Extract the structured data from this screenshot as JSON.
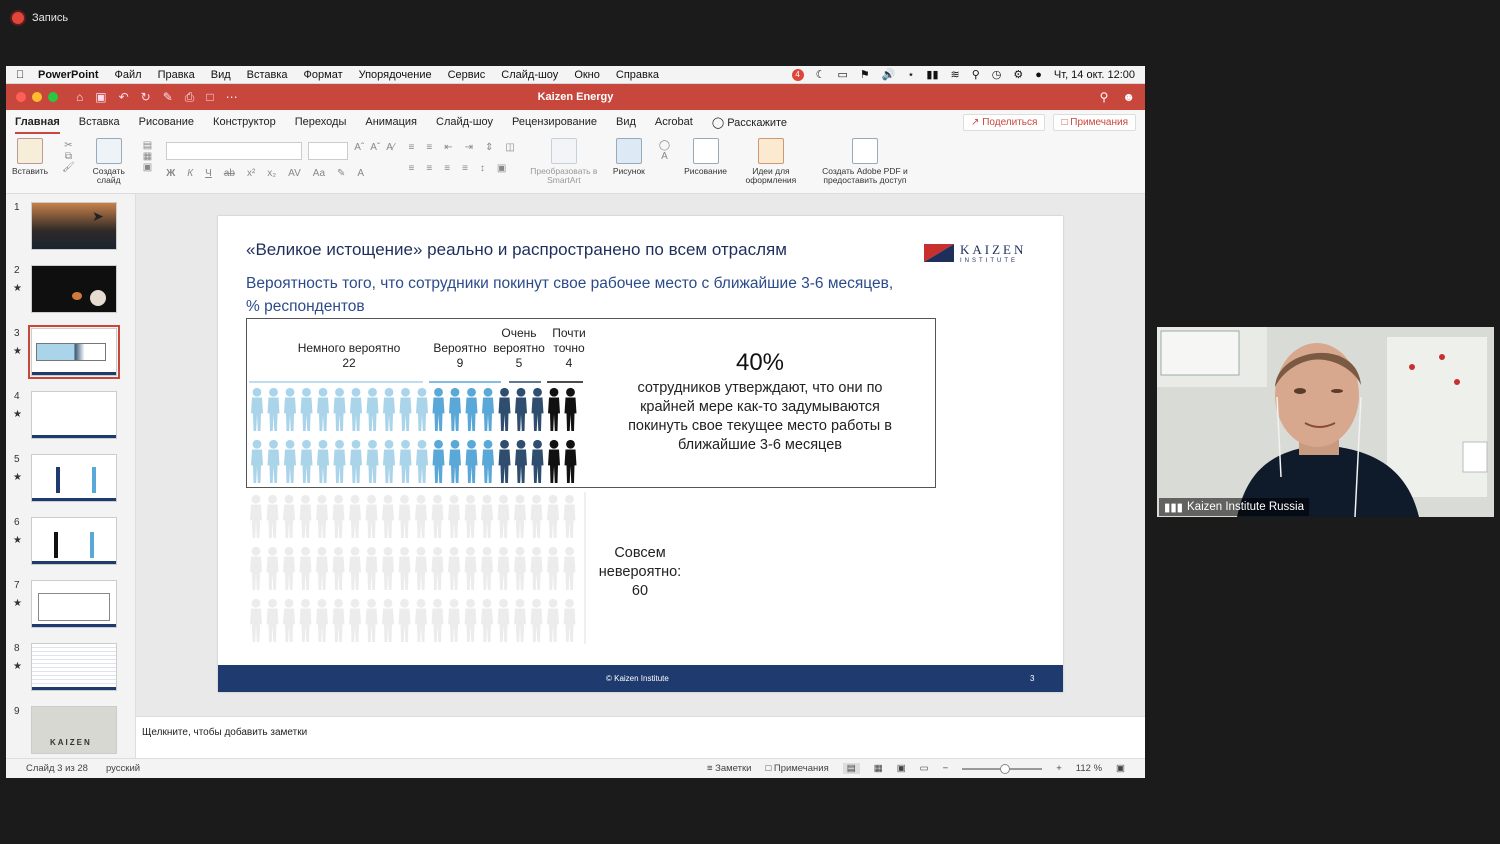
{
  "recording": {
    "label": "Запись"
  },
  "menubar": {
    "app": "PowerPoint",
    "items": [
      "Файл",
      "Правка",
      "Вид",
      "Вставка",
      "Формат",
      "Упорядочение",
      "Сервис",
      "Слайд-шоу",
      "Окно",
      "Справка"
    ],
    "notification_count": "4",
    "clock": "Чт, 14 окт.  12:00"
  },
  "titlebar": {
    "document": "Kaizen Energy"
  },
  "tabs": {
    "items": [
      "Главная",
      "Вставка",
      "Рисование",
      "Конструктор",
      "Переходы",
      "Анимация",
      "Слайд-шоу",
      "Рецензирование",
      "Вид",
      "Acrobat"
    ],
    "tell_me": "Расскажите",
    "share": "Поделиться",
    "comments": "Примечания"
  },
  "ribbon": {
    "paste": "Вставить",
    "new_slide": "Создать слайд",
    "smartart": "Преобразовать в SmartArt",
    "picture": "Рисунок",
    "drawing": "Рисование",
    "design_ideas": "Идеи для оформления",
    "adobe": "Создать Adobe PDF и предоставить доступ"
  },
  "thumbnails": {
    "numbers": [
      "1",
      "2",
      "3",
      "4",
      "5",
      "6",
      "7",
      "8",
      "9"
    ],
    "slide9_word": "KAIZEN"
  },
  "slide": {
    "title": "«Великое истощение» реально и распространено по всем отраслям",
    "subtitle": "Вероятность того, что сотрудники покинут свое рабочее место с ближайшие 3-6 месяцев, % респондентов",
    "logo": "KAIZEN",
    "logo_sub": "INSTITUTE",
    "categories": [
      {
        "label": "Немного вероятно",
        "value": "22"
      },
      {
        "label": "Вероятно",
        "value": "9"
      },
      {
        "label": "Очень вероятно",
        "value": "5"
      },
      {
        "label": "Почти точно",
        "value": "4"
      }
    ],
    "headline_pct": "40%",
    "headline_text": "сотрудников утверждают, что они по крайней мере как-то задумываются покинуть свое текущее место работы в ближайшие 3-6 месяцев",
    "unlikely_label": "Совсем невероятно:",
    "unlikely_value": "60",
    "footer": "© Kaizen Institute",
    "page": "3",
    "colors": {
      "light": "#a9d4ea",
      "mid": "#5aa8d8",
      "dark": "#2f4d6e",
      "black": "#111",
      "grey": "#ececec",
      "navy": "#1e3a6e"
    }
  },
  "notes": {
    "placeholder": "Щелкните, чтобы добавить заметки"
  },
  "status": {
    "slide": "Слайд 3 из 28",
    "lang": "русский",
    "notes": "Заметки",
    "comments": "Примечания",
    "zoom": "112 %"
  },
  "webcam": {
    "name": "Kaizen Institute Russia"
  }
}
